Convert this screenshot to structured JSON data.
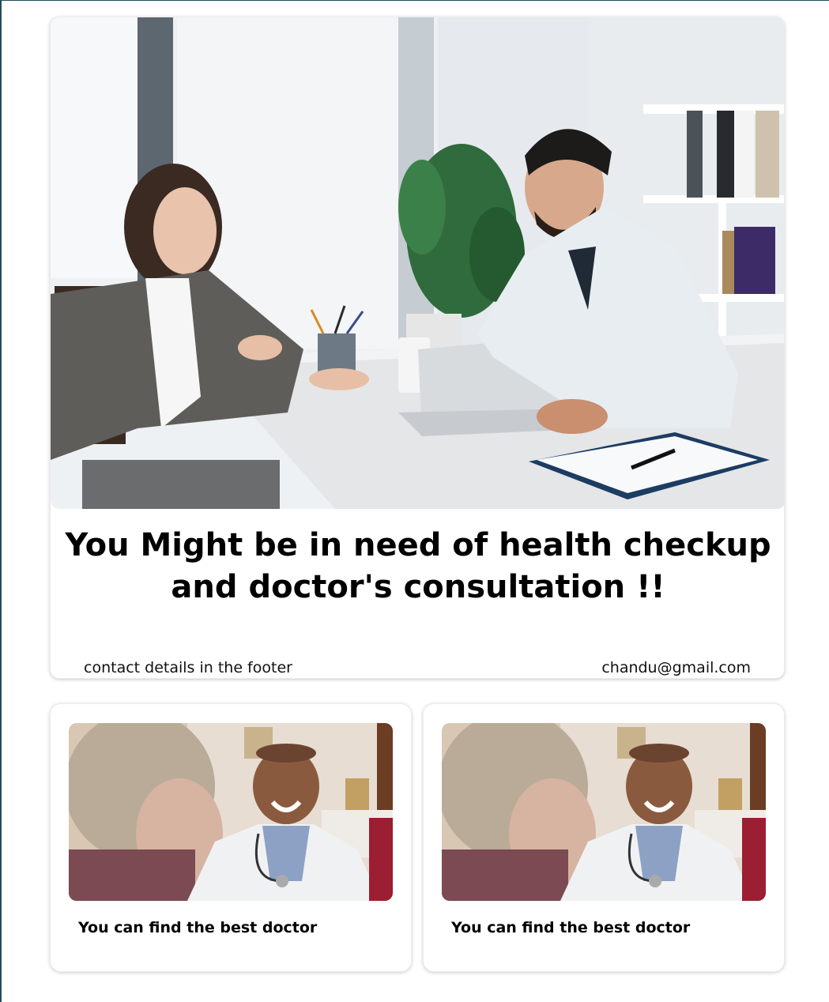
{
  "hero": {
    "image_alt": "doctor consultation photo",
    "title": "You Might be in need of health checkup and doctor's consultation !!",
    "footer_left": "contact details in the footer",
    "footer_right": "chandu@gmail.com"
  },
  "cards": [
    {
      "image_alt": "smiling doctor photo",
      "caption": "You can find the best doctor"
    },
    {
      "image_alt": "smiling doctor photo",
      "caption": "You can find the best doctor"
    }
  ],
  "colors": {
    "page_edge": "#1f4e5a",
    "text": "#000000",
    "card_background": "#ffffff"
  }
}
